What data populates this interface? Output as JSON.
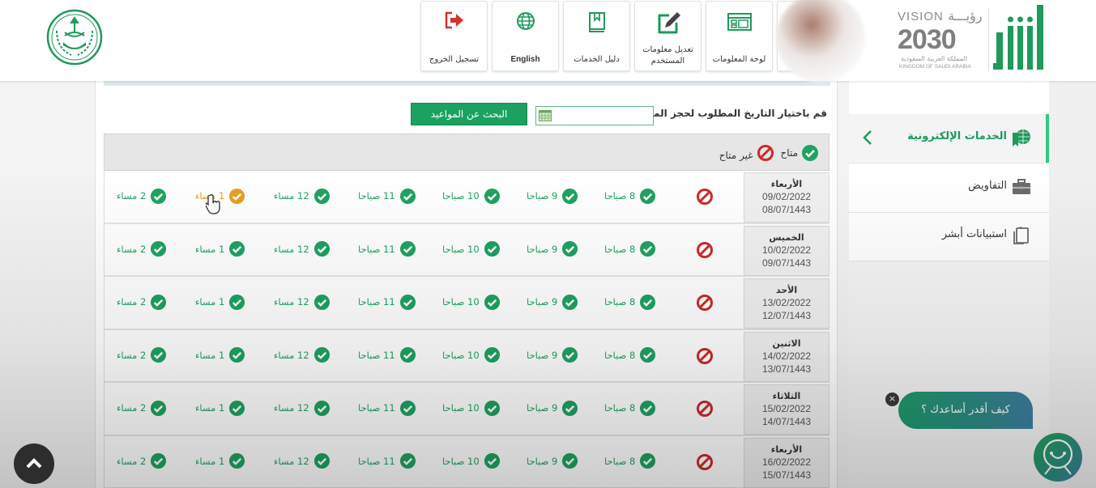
{
  "header": {
    "nav_buttons": [
      {
        "label": "تسجيل الخروج",
        "icon": "logout-icon"
      },
      {
        "label": "English",
        "icon": "globe-icon"
      },
      {
        "label": "دليل الخدمات",
        "icon": "book-icon"
      },
      {
        "label": "تعديل معلومات المستخدم",
        "icon": "edit-icon"
      },
      {
        "label": "لوحة المعلومات",
        "icon": "dashboard-icon"
      }
    ],
    "vision": {
      "en": "VISION",
      "ar": "رؤيـــة",
      "year": "2030",
      "ksa_ar": "المملكة العربية السعودية",
      "ksa_en": "KINGDOM OF SAUDI ARABIA"
    }
  },
  "booking": {
    "date_label": "قم باختيار التاريخ المطلوب لحجز الموعد :",
    "date_value": "",
    "search_button": "البحث عن المواعيد",
    "legend": {
      "available": "متاح",
      "unavailable": "غير متاح"
    }
  },
  "colors": {
    "primary_green": "#1aa25e",
    "available": "#1ea361",
    "unavailable": "#cc2a2a",
    "hover": "#e6a020",
    "chat_gradient_end": "#3f7ea2"
  },
  "slot_labels": [
    "8 صباحا",
    "9 صباحا",
    "10 صباحا",
    "11 صباحا",
    "12 مساء",
    "1 مساء",
    "2 مساء"
  ],
  "days": [
    {
      "name": "الأربعاء",
      "gregorian": "09/02/2022",
      "hijri": "08/07/1443",
      "first_unavailable": true,
      "hover_slot": 5
    },
    {
      "name": "الخميس",
      "gregorian": "10/02/2022",
      "hijri": "09/07/1443",
      "first_unavailable": true
    },
    {
      "name": "الأحد",
      "gregorian": "13/02/2022",
      "hijri": "12/07/1443",
      "first_unavailable": true
    },
    {
      "name": "الاثنين",
      "gregorian": "14/02/2022",
      "hijri": "13/07/1443",
      "first_unavailable": true
    },
    {
      "name": "الثلاثاء",
      "gregorian": "15/02/2022",
      "hijri": "14/07/1443",
      "first_unavailable": true
    },
    {
      "name": "الأربعاء",
      "gregorian": "16/02/2022",
      "hijri": "15/07/1443",
      "first_unavailable": true
    }
  ],
  "sidebar": {
    "items": [
      {
        "label": "الخدمات الإلكترونية",
        "icon": "e-services-icon",
        "active": true
      },
      {
        "label": "التفاويض",
        "icon": "briefcase-icon"
      },
      {
        "label": "استبيانات أبشر",
        "icon": "survey-icon"
      }
    ]
  },
  "chat": {
    "prompt": "كيف أقدر أساعدك ؟",
    "close": "×"
  }
}
